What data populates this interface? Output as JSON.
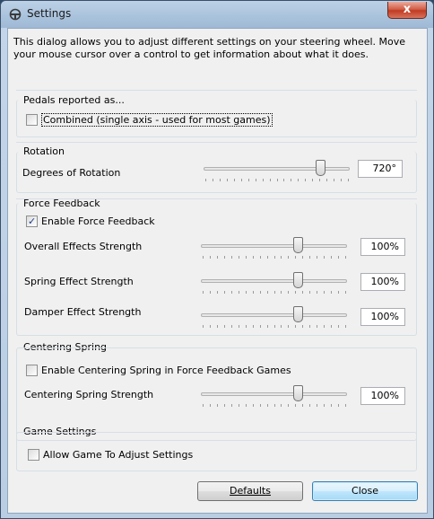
{
  "window": {
    "title": "Settings",
    "close_glyph": "x"
  },
  "intro": "This dialog allows you to adjust different settings on your steering wheel.  Move your mouse cursor over a control to get information about what it does.",
  "pedals": {
    "group_label": "Pedals reported as...",
    "combined_label": "Combined (single axis - used for most games)",
    "combined_checked": false
  },
  "rotation": {
    "group_label": "Rotation",
    "degrees_label": "Degrees of Rotation",
    "degrees_value": "720°",
    "degrees_level": 0.8
  },
  "force_feedback": {
    "group_label": "Force Feedback",
    "enable_label": "Enable Force Feedback",
    "enable_checked": true,
    "overall_label": "Overall Effects Strength",
    "overall_value": "100%",
    "overall_level": 0.66,
    "spring_label": "Spring Effect Strength",
    "spring_value": "100%",
    "spring_level": 0.66,
    "damper_label": "Damper Effect Strength",
    "damper_value": "100%",
    "damper_level": 0.66
  },
  "centering": {
    "group_label": "Centering Spring",
    "enable_label": "Enable Centering Spring in Force Feedback Games",
    "enable_checked": false,
    "strength_label": "Centering Spring Strength",
    "strength_value": "100%",
    "strength_level": 0.66
  },
  "game": {
    "group_label": "Game Settings",
    "allow_label": "Allow Game To Adjust Settings",
    "allow_checked": false
  },
  "buttons": {
    "defaults": "Defaults",
    "close": "Close"
  },
  "colors": {
    "close_button": "#c03b22",
    "default_button_border": "#3c7fb1"
  }
}
